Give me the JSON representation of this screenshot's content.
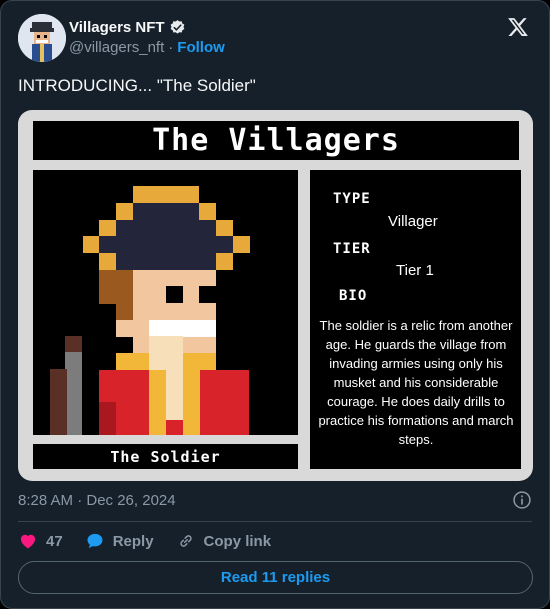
{
  "account": {
    "display_name": "Villagers NFT",
    "handle": "@villagers_nft",
    "separator": "·",
    "follow_label": "Follow",
    "verified": true
  },
  "tweet": {
    "text": "INTRODUCING... \"The Soldier\"",
    "timestamp": "8:28 AM · Dec 26, 2024"
  },
  "card": {
    "title": "The Villagers",
    "name_plate": "The Soldier",
    "type_label": "TYPE",
    "type_value": "Villager",
    "tier_label": "TIER",
    "tier_value": "Tier 1",
    "bio_label": "BIO",
    "bio_text": "The soldier is a relic from another age. He guards the village from invading armies using only his musket and his considerable courage. He does daily drills to practice his formations and march steps."
  },
  "actions": {
    "like_count": "47",
    "reply_label": "Reply",
    "copy_label": "Copy link",
    "read_replies_label": "Read 11 replies"
  },
  "colors": {
    "background": "#15202b",
    "accent": "#1d9bf0",
    "like": "#f91880",
    "muted": "#8b98a5"
  },
  "icons": [
    "verified-badge-icon",
    "x-logo-icon",
    "info-icon",
    "heart-icon",
    "reply-bubble-icon",
    "link-icon"
  ]
}
